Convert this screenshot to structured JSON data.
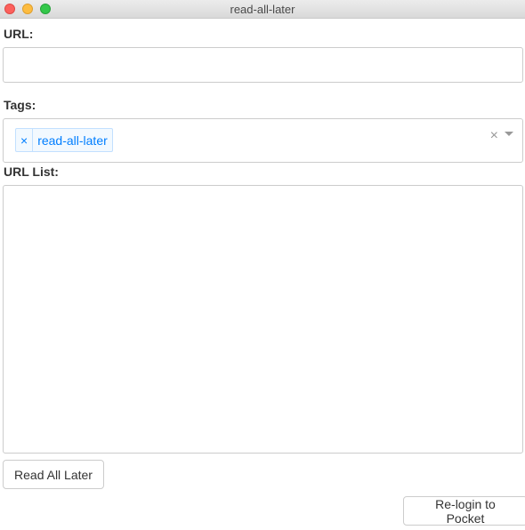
{
  "window": {
    "title": "read-all-later"
  },
  "url_field": {
    "label": "URL:",
    "value": "",
    "placeholder": ""
  },
  "tags_field": {
    "label": "Tags:",
    "selected_tags": [
      {
        "label": "read-all-later",
        "remove_glyph": "×"
      }
    ],
    "clear_glyph": "×"
  },
  "url_list": {
    "label": "URL List:",
    "value": ""
  },
  "buttons": {
    "read_all_later": "Read All Later",
    "relogin": "Re-login to Pocket"
  },
  "colors": {
    "tag_text": "#007eff",
    "tag_background": "#f2f9ff",
    "tag_border": "#c2e0ff",
    "close_light": "#fc605c",
    "minimize_light": "#fdbc40",
    "maximize_light": "#34c84a"
  }
}
